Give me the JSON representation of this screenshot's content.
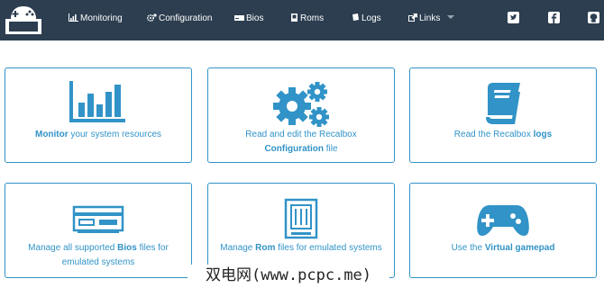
{
  "colors": {
    "navbar": "#2c3e50",
    "accent": "#3193c7",
    "nav_text": "#ffffff"
  },
  "navbar": {
    "brand_icon": "gamepad-logo-icon",
    "items": [
      {
        "label": "Monitoring",
        "icon": "bar-chart-icon"
      },
      {
        "label": "Configuration",
        "icon": "cogs-icon"
      },
      {
        "label": "Bios",
        "icon": "console-icon"
      },
      {
        "label": "Roms",
        "icon": "cartridge-icon"
      },
      {
        "label": "Logs",
        "icon": "book-icon"
      },
      {
        "label": "Links",
        "icon": "external-link-icon"
      }
    ],
    "social": [
      "twitter-icon",
      "facebook-icon",
      "github-icon"
    ]
  },
  "cards": [
    {
      "icon": "bar-chart-icon",
      "bold": "Monitor",
      "text": " your system resources"
    },
    {
      "icon": "cogs-icon",
      "line1": "Read and edit the Recalbox",
      "bold": "Configuration",
      "text": " file"
    },
    {
      "icon": "book-icon",
      "text": "Read the Recalbox ",
      "bold": "logs"
    },
    {
      "icon": "console-icon",
      "pre": "Manage all supported ",
      "bold": "Bios",
      "text": " files for emulated systems"
    },
    {
      "icon": "cartridge-icon",
      "pre": "Manage ",
      "bold": "Rom",
      "text": " files for emulated systems"
    },
    {
      "icon": "gamepad-icon",
      "pre": "Use the ",
      "bold": "Virtual gamepad"
    }
  ],
  "watermark": "双电网(www.pcpc.me)"
}
